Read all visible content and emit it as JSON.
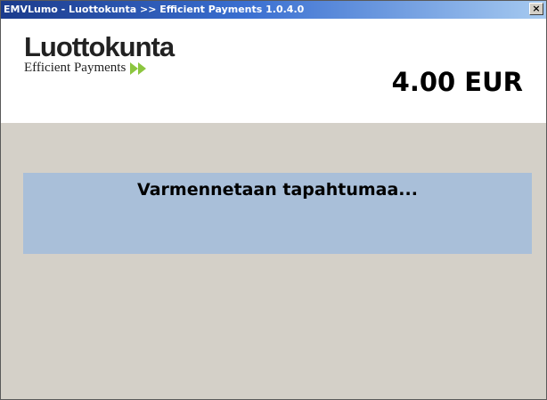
{
  "window": {
    "title": "EMVLumo - Luottokunta >> Efficient Payments 1.0.4.0",
    "close_glyph": "×"
  },
  "header": {
    "logo_brand": "Luottokunta",
    "logo_tagline": "Efficient Payments",
    "logo_arrow_icon": "double-arrow-right-icon",
    "amount": "4.00 EUR"
  },
  "status": {
    "message": "Varmennetaan tapahtumaa..."
  },
  "colors": {
    "titlebar_start": "#1b3b8c",
    "titlebar_end": "#a6caf0",
    "window_bg": "#d4d0c8",
    "status_panel_bg": "#a9bfd9",
    "logo_arrow": "#8cc63f"
  }
}
